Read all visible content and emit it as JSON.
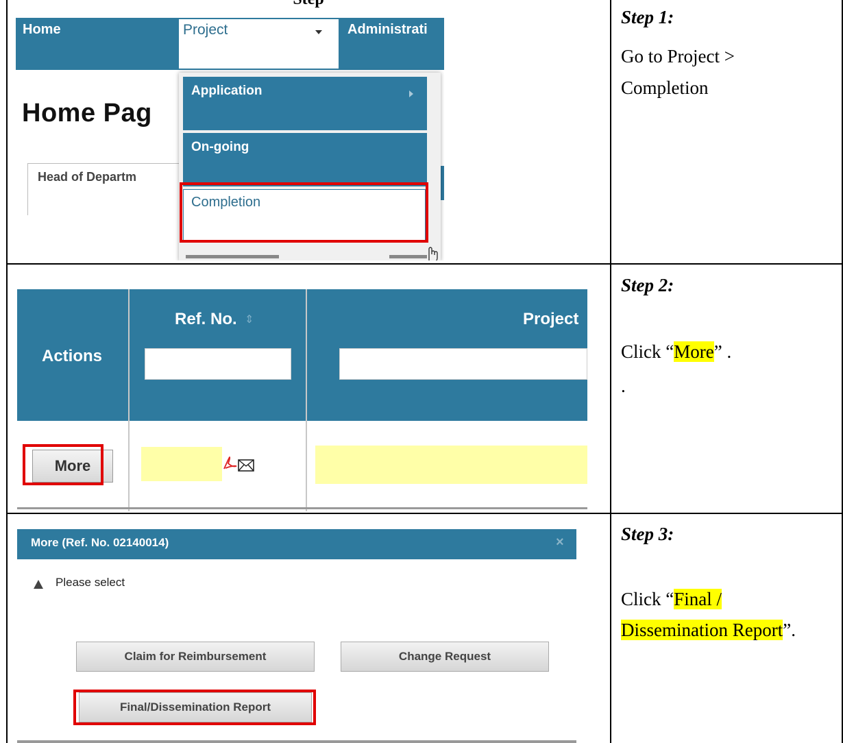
{
  "document": {
    "title": "Step"
  },
  "steps": [
    {
      "title": "Step 1:",
      "lines": [
        "Go to Project >",
        "Completion"
      ]
    },
    {
      "title": "Step 2:",
      "prefix": "Click “",
      "highlight": "More",
      "suffix": "” .",
      "extra": "."
    },
    {
      "title": "Step 3:",
      "prefix": "Click “",
      "highlight1": "Final /",
      "highlight2": "Dissemination Report",
      "suffix": "”."
    }
  ],
  "panel1": {
    "nav": {
      "home": "Home",
      "project": "Project",
      "administration": "Administrati"
    },
    "page_title": "Home Pag",
    "tab_label": "Head of Departm",
    "dropdown": {
      "application": "Application",
      "ongoing": "On-going",
      "completion": "Completion"
    }
  },
  "panel2": {
    "headers": {
      "actions": "Actions",
      "ref_no": "Ref. No.",
      "project": "Project"
    },
    "sort_glyph": "⇕",
    "more_button": "More",
    "pdf_glyph": "┵"
  },
  "panel3": {
    "dialog_title": "More (Ref. No. 02140014)",
    "close_glyph": "×",
    "prompt": "Please select",
    "buttons": {
      "claim": "Claim for Reimbursement",
      "change": "Change Request",
      "final": "Final/Dissemination Report"
    }
  },
  "colors": {
    "header_blue": "#2e7a9e",
    "highlight_red": "#e00000",
    "highlight_yellow": "#ffff00"
  }
}
